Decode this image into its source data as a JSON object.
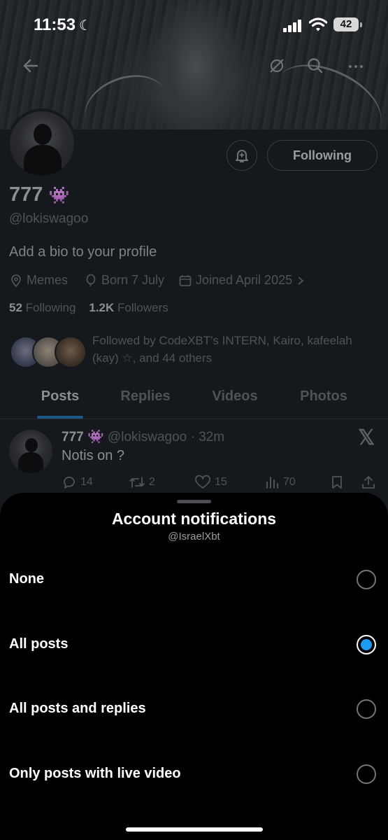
{
  "status_bar": {
    "time": "11:53",
    "battery": "42"
  },
  "profile": {
    "name": "777",
    "name_emoji": "👾",
    "handle": "@lokiswagoo",
    "bio": "Add a bio to your profile",
    "following_button": "Following",
    "meta": {
      "location": "Memes",
      "birthday": "Born 7 July",
      "joined": "Joined April 2025"
    },
    "following_count": "52",
    "following_label": "Following",
    "followers_count": "1.2K",
    "followers_label": "Followers",
    "followed_by": "Followed by CodeXBT's INTERN, Kairo, kafeelah (kay) ☆, and 44 others"
  },
  "tabs": [
    {
      "label": "Posts"
    },
    {
      "label": "Replies"
    },
    {
      "label": "Videos"
    },
    {
      "label": "Photos"
    }
  ],
  "post": {
    "name": "777",
    "emoji": "👾",
    "handle_time": "@lokiswagoo · 32m",
    "text": "Notis on ?",
    "replies": "14",
    "reposts": "2",
    "likes": "15",
    "views": "70"
  },
  "sheet": {
    "title": "Account notifications",
    "subtitle": "@IsraelXbt",
    "options": [
      {
        "label": "None",
        "selected": false
      },
      {
        "label": "All posts",
        "selected": true
      },
      {
        "label": "All posts and replies",
        "selected": false
      },
      {
        "label": "Only posts with live video",
        "selected": false
      }
    ]
  },
  "colors": {
    "accent": "#1d9bf0",
    "sheet_bg": "#000000",
    "page_bg": "#15181c"
  },
  "icons": [
    "back-arrow-icon",
    "slash-circle-icon",
    "search-icon",
    "more-icon",
    "bell-icon",
    "location-icon",
    "balloon-icon",
    "calendar-icon",
    "chevron-right-icon",
    "x-logo-icon",
    "reply-icon",
    "repost-icon",
    "like-icon",
    "views-icon",
    "bookmark-icon",
    "share-icon"
  ]
}
